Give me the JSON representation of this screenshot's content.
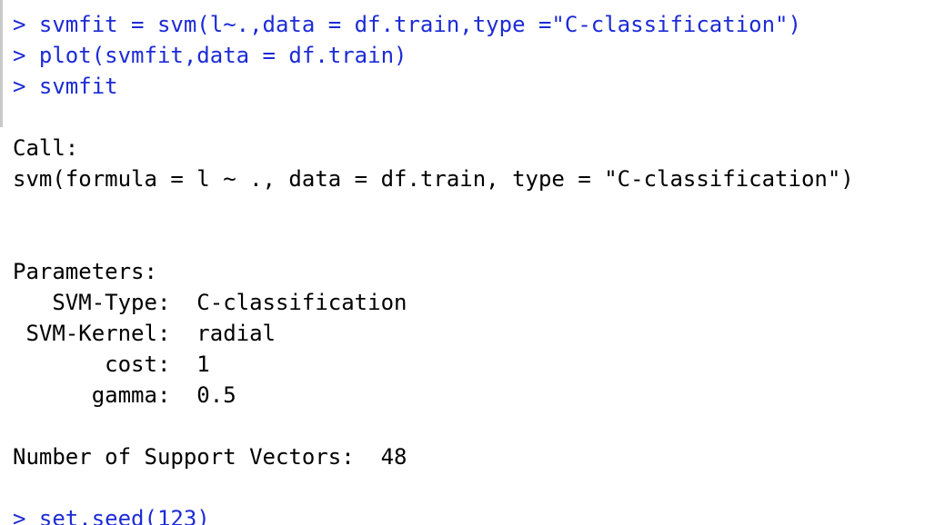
{
  "console": {
    "partial_prompt": ">",
    "commands": [
      "> svmfit = svm(l~.,data = df.train,type =\"C-classification\")",
      "> plot(svmfit,data = df.train)",
      "> svmfit"
    ],
    "call_header": "Call:",
    "call_text": "svm(formula = l ~ ., data = df.train, type = \"C-classification\")",
    "parameters_header": "Parameters:",
    "params": [
      "   SVM-Type:  C-classification",
      " SVM-Kernel:  radial",
      "       cost:  1",
      "      gamma:  0.5"
    ],
    "support_vectors": "Number of Support Vectors:  48",
    "next_command": "> set.seed(123)"
  }
}
